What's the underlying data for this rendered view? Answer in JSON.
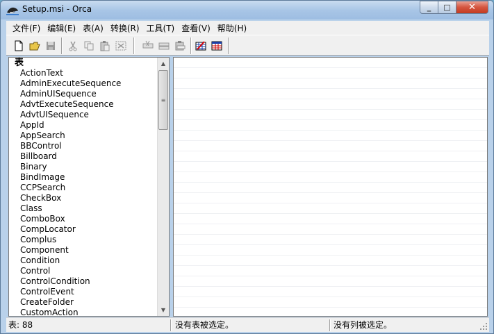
{
  "window": {
    "title": "Setup.msi - Orca"
  },
  "caption": {
    "min": "_",
    "max": "□",
    "close": "✕"
  },
  "menu": [
    "文件(F)",
    "编辑(E)",
    "表(A)",
    "转换(R)",
    "工具(T)",
    "查看(V)",
    "帮助(H)"
  ],
  "toolbar": {
    "icons": [
      "new-document-icon",
      "open-folder-icon",
      "save-icon",
      "cut-icon",
      "copy-icon",
      "paste-icon",
      "drop-table-icon",
      "cut-row-icon",
      "copy-row-icon",
      "paste-row-icon",
      "validate-icon",
      "table-icon"
    ]
  },
  "tables": {
    "header": "表",
    "items": [
      "ActionText",
      "AdminExecuteSequence",
      "AdminUISequence",
      "AdvtExecuteSequence",
      "AdvtUISequence",
      "AppId",
      "AppSearch",
      "BBControl",
      "Billboard",
      "Binary",
      "BindImage",
      "CCPSearch",
      "CheckBox",
      "Class",
      "ComboBox",
      "CompLocator",
      "Complus",
      "Component",
      "Condition",
      "Control",
      "ControlCondition",
      "ControlEvent",
      "CreateFolder",
      "CustomAction"
    ]
  },
  "status": {
    "table_count": "表: 88",
    "table_selection": "没有表被选定。",
    "column_selection": "没有列被选定。"
  },
  "colors": {
    "title_gradient_top": "#c9dcf0",
    "title_gradient_bottom": "#9dbde2",
    "close_red": "#c23b22",
    "chrome": "#f0f0f0"
  }
}
